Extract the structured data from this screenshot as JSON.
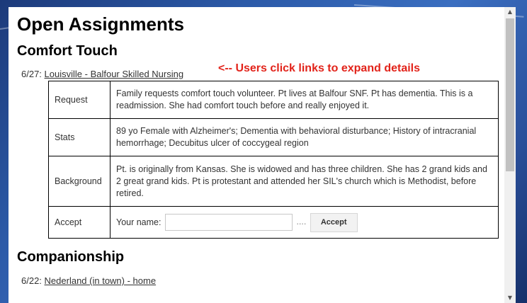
{
  "page": {
    "title": "Open Assignments",
    "annotation": "<-- Users click links to expand details"
  },
  "sections": [
    {
      "heading": "Comfort Touch",
      "date": "6/27:",
      "link": "Louisville - Balfour Skilled Nursing",
      "details": {
        "request_label": "Request",
        "request_text": "Family requests comfort touch volunteer. Pt lives at Balfour SNF. Pt has dementia. This is a readmission. She had comfort touch before and really enjoyed it.",
        "stats_label": "Stats",
        "stats_text": "89 yo Female with Alzheimer's; Dementia with behavioral disturbance; History of intracranial hemorrhage; Decubitus ulcer of coccygeal region",
        "background_label": "Background",
        "background_text": "Pt. is originally from Kansas. She is widowed and has three children. She has 2 grand kids and 2 great grand kids. Pt is protestant and attended her SIL's church which is Methodist, before retired.",
        "accept_label": "Accept",
        "your_name_label": "Your name:",
        "name_value": "",
        "dots": "....",
        "accept_button": "Accept"
      }
    },
    {
      "heading": "Companionship",
      "date": "6/22:",
      "link": "Nederland (in town) - home"
    }
  ],
  "scrollbar": {
    "up_icon": "▲",
    "down_icon": "▼"
  }
}
